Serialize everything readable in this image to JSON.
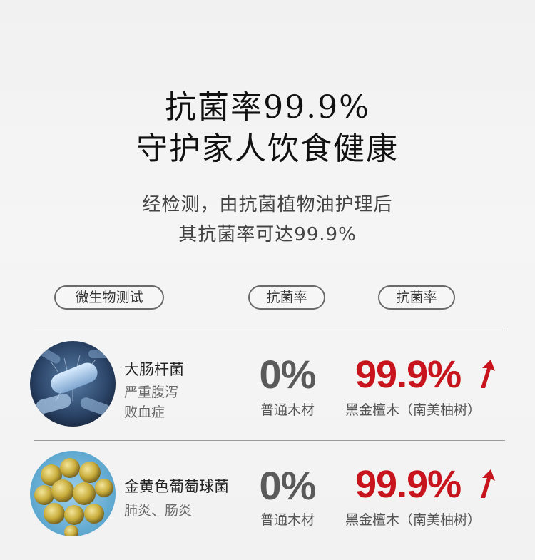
{
  "header": {
    "title_line1": "抗菌率99.9%",
    "title_line2": "守护家人饮食健康",
    "subtitle_line1": "经检测，由抗菌植物油护理后",
    "subtitle_line2": "其抗菌率可达99.9%"
  },
  "columns": {
    "test": "微生物测试",
    "rate1": "抗菌率",
    "rate2": "抗菌率"
  },
  "rows": [
    {
      "name": "大肠杆菌",
      "desc_line1": "严重腹泻",
      "desc_line2": "败血症",
      "plain_value": "0%",
      "plain_label": "普通木材",
      "treated_value": "99.9%",
      "treated_label": "黑金檀木（南美柚树）"
    },
    {
      "name": "金黄色葡萄球菌",
      "desc_line1": "肺炎、肠炎",
      "plain_value": "0%",
      "plain_label": "普通木材",
      "treated_value": "99.9%",
      "treated_label": "黑金檀木（南美柚树）"
    }
  ],
  "colors": {
    "accent_red": "#c8141c",
    "gray_value": "#5a5a5a"
  },
  "icons": [
    "e-coli-image",
    "staphylococcus-image",
    "up-arrow-icon"
  ]
}
